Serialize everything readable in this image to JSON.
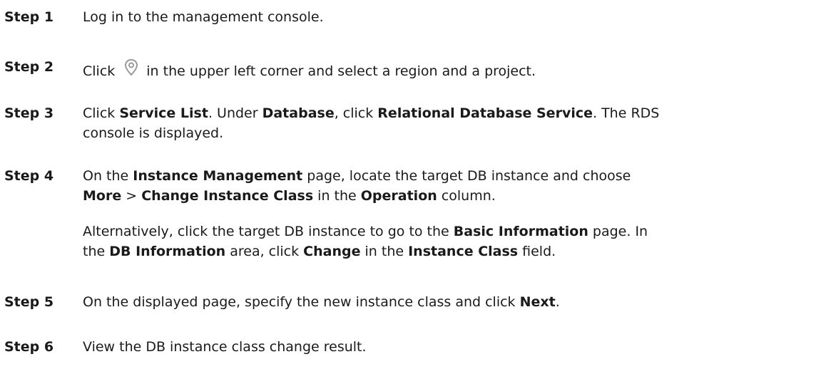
{
  "steps": [
    {
      "label": "Step 1",
      "text": "Log in to the management console."
    },
    {
      "label": "Step 2",
      "pre": "Click",
      "icon": "location-pin-icon",
      "post": "in the upper left corner and select a region and a project."
    },
    {
      "label": "Step 3",
      "t1": "Click ",
      "b1": "Service List",
      "t2": ". Under ",
      "b2": "Database",
      "t3": ", click ",
      "b3": "Relational Database Service",
      "t4": ". The RDS",
      "line2": "console is displayed."
    },
    {
      "label": "Step 4",
      "t1": "On the ",
      "b1": "Instance Management",
      "t2": " page, locate the target DB instance and choose",
      "b2": "More",
      "t3": " > ",
      "b3": "Change Instance Class",
      "t4": " in the ",
      "b4": "Operation",
      "t5": " column.",
      "alt": {
        "t1": "Alternatively, click the target DB instance to go to the ",
        "b1": "Basic Information",
        "t2": " page. In",
        "t3": "the ",
        "b2": "DB Information",
        "t4": " area, click ",
        "b3": "Change",
        "t5": " in the ",
        "b4": "Instance Class",
        "t6": " field."
      }
    },
    {
      "label": "Step 5",
      "t1": "On the displayed page, specify the new instance class and click ",
      "b1": "Next",
      "t2": "."
    },
    {
      "label": "Step 6",
      "text": "View the DB instance class change result."
    }
  ],
  "colors": {
    "text": "#1a1a1a",
    "icon": "#9a9a9a"
  }
}
